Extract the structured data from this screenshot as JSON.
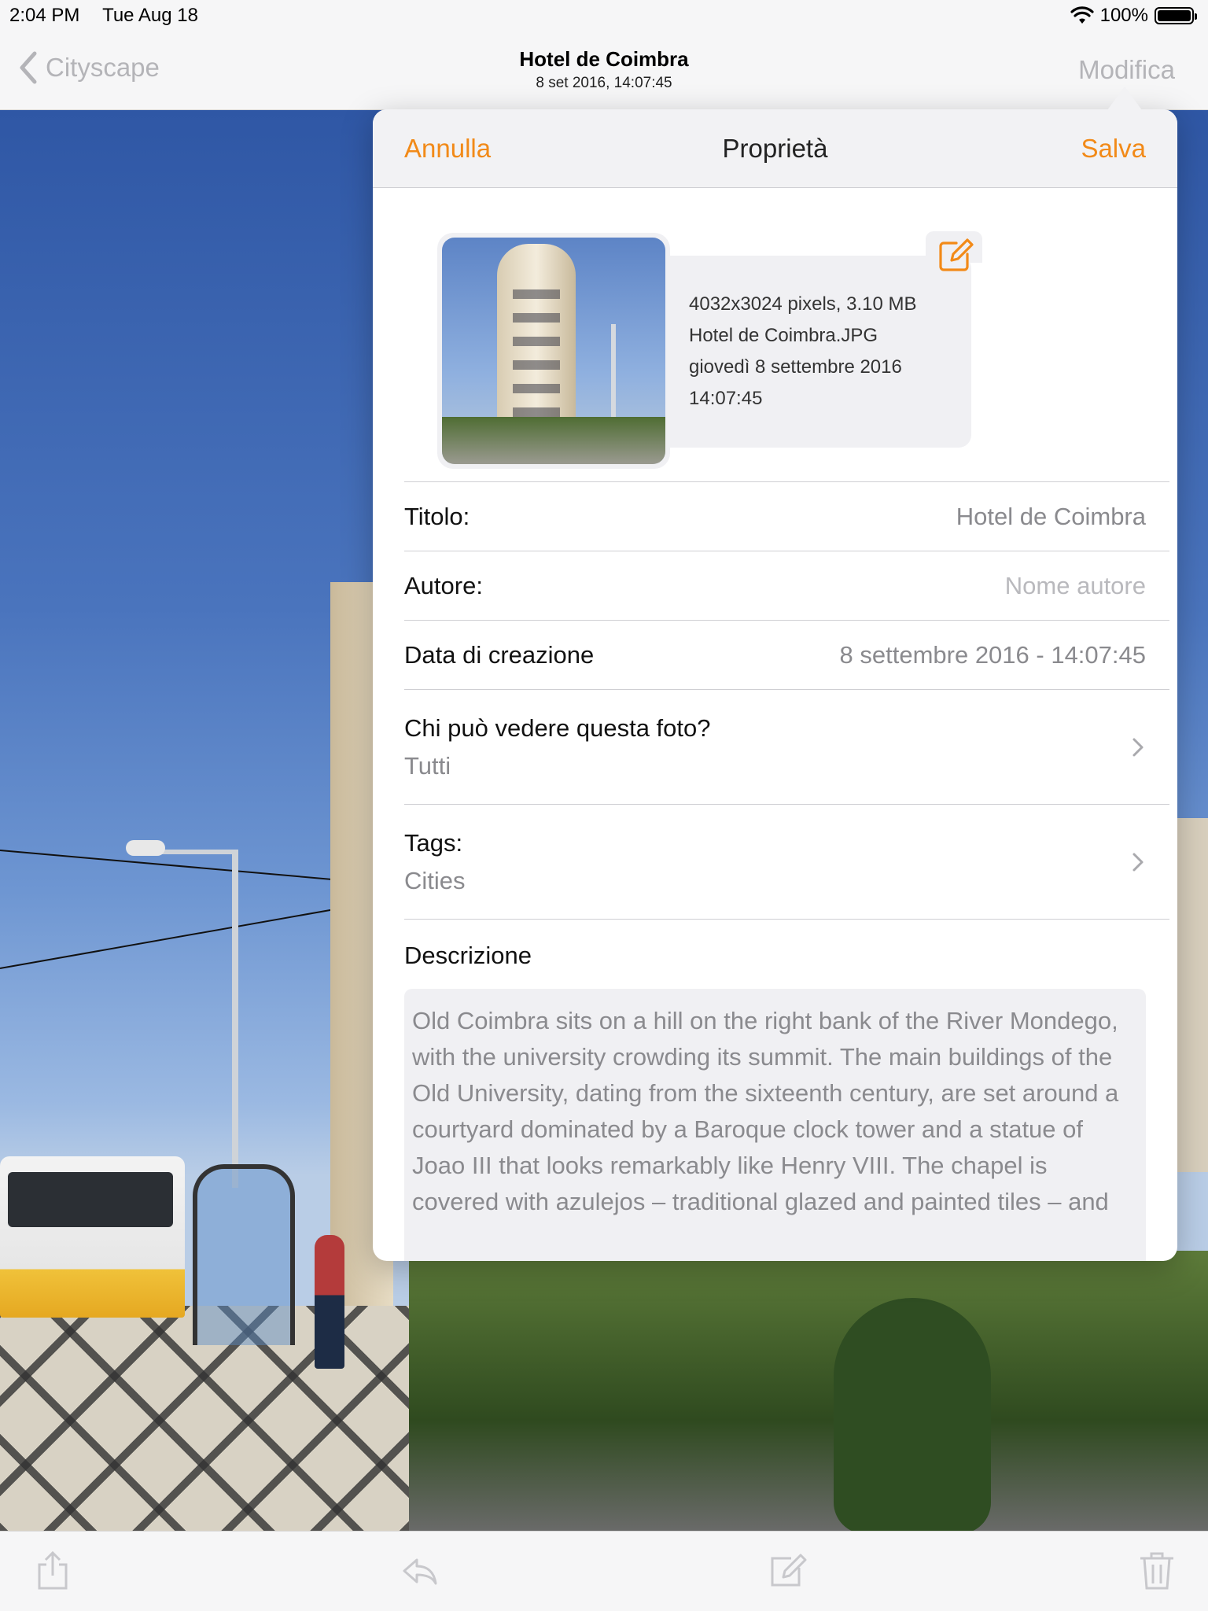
{
  "status_bar": {
    "time": "2:04 PM",
    "date": "Tue Aug 18",
    "battery_percent": "100%",
    "battery_level": 1.0
  },
  "nav_bar": {
    "back_label": "Cityscape",
    "title": "Hotel de Coimbra",
    "subtitle": "8 set 2016, 14:07:45",
    "edit_label": "Modifica"
  },
  "popover": {
    "cancel_label": "Annulla",
    "title": "Proprietà",
    "save_label": "Salva",
    "photo_info": {
      "dimensions_size": "4032x3024 pixels, 3.10 MB",
      "filename": "Hotel de Coimbra.JPG",
      "date": "giovedì 8 settembre 2016",
      "time": "14:07:45"
    },
    "fields": {
      "title_label": "Titolo:",
      "title_value": "Hotel de Coimbra",
      "author_label": "Autore:",
      "author_placeholder": "Nome autore",
      "created_label": "Data di creazione",
      "created_value": "8 settembre 2016 - 14:07:45",
      "visibility_label": "Chi può vedere questa foto?",
      "visibility_value": "Tutti",
      "tags_label": "Tags:",
      "tags_value": "Cities",
      "description_label": "Descrizione",
      "description_text": "Old Coimbra sits on a hill on the right bank of the River Mondego, with the university crowding its summit. The main buildings of the Old University, dating from the sixteenth century, are set around a courtyard dominated by a Baroque clock tower and a statue of Joao III that looks remarkably like Henry VIII. The chapel is covered with azulejos – traditional glazed and painted tiles – and"
    }
  },
  "toolbar": {
    "icons": [
      "share-icon",
      "reply-icon",
      "compose-icon",
      "trash-icon"
    ]
  },
  "colors": {
    "accent": "#f28a18",
    "disabled": "#b4b4b8",
    "secondary_text": "#8a8a8e"
  }
}
